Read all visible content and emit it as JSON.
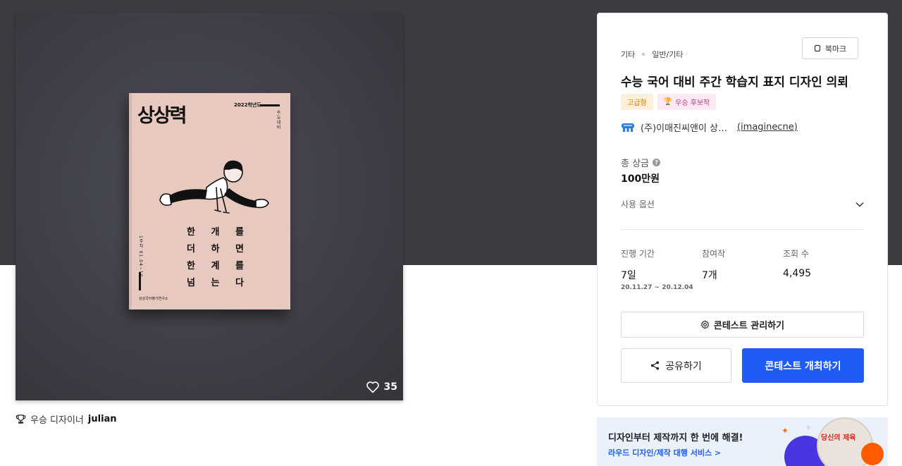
{
  "artwork": {
    "likes": "35",
    "cover": {
      "logo": "상상력",
      "year": "2022학년도",
      "vertical_text": "수능대비",
      "side_text": "1주차 01.04~10",
      "lines": [
        "한 개 를",
        "더 하 면",
        "한 계 를",
        "넘 는 다"
      ],
      "publisher": "상상국어평가연구소"
    }
  },
  "winner": {
    "label": "우승 디자이너",
    "name": "julian"
  },
  "panel": {
    "breadcrumb": [
      "기타",
      "일반/기타"
    ],
    "bookmark_label": "북마크",
    "title": "수능 국어 대비 주간 학습지 표지 디자인 의뢰",
    "badges": {
      "grade": "고급형",
      "winner": "우승 후보작"
    },
    "host": {
      "name": "(주)이매진씨앤이 상…",
      "id": "(imaginecne)"
    },
    "prize": {
      "label": "총 상금",
      "value": "100만원"
    },
    "usage_label": "사용 옵션",
    "stats": {
      "period": {
        "label": "진행 기간",
        "value": "7일",
        "range": "20.11.27  ~  20.12.04"
      },
      "participants": {
        "label": "참여작",
        "value": "7개"
      },
      "views": {
        "label": "조회 수",
        "value": "4,495"
      }
    },
    "manage_label": "콘테스트 관리하기",
    "share_label": "공유하기",
    "host_contest_label": "콘테스트 개최하기"
  },
  "ad": {
    "headline": "디자인부터 제작까지 한 번에 해결!",
    "link": "라우드 디자인/제작 대행 서비스 >",
    "logo_text": "당신의 제육"
  },
  "colors": {
    "top_band": "#3b3c42",
    "accent": "#1f5bf6",
    "badge_grade": "#d07a00",
    "badge_winner": "#b13c86",
    "cover": "#e8c9bf"
  }
}
